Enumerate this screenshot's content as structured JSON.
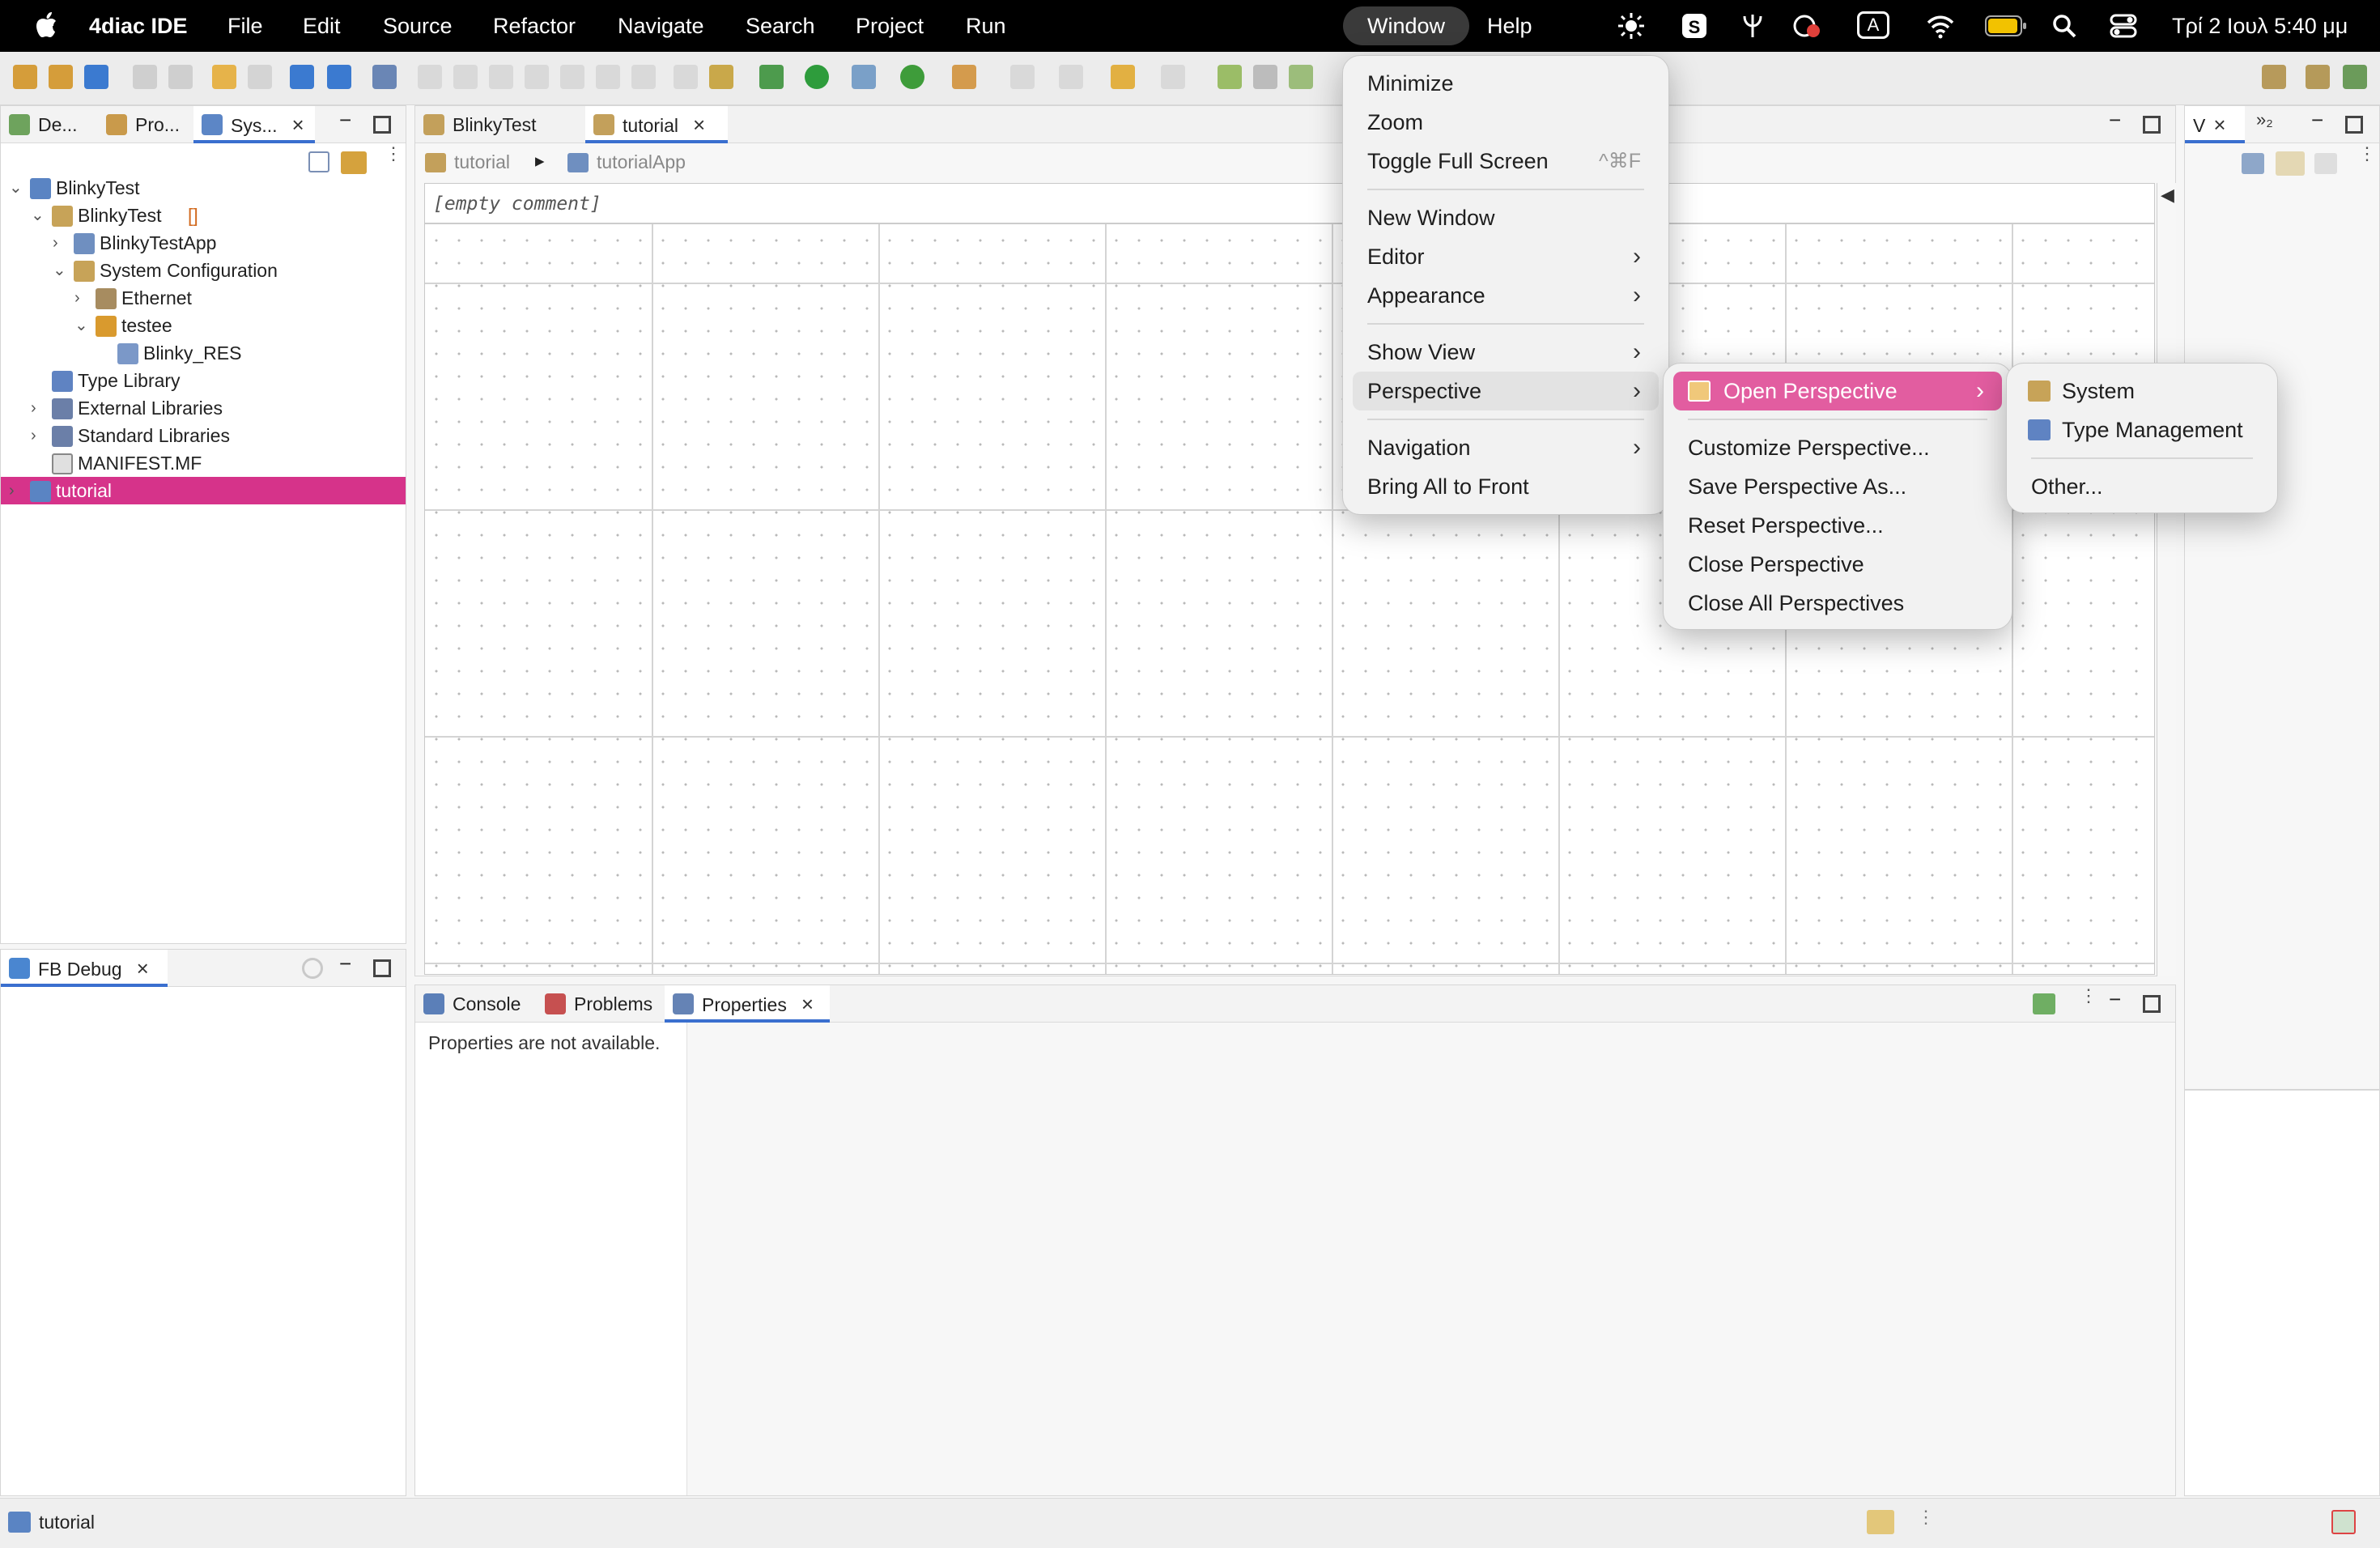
{
  "menubar": {
    "app_name": "4diac IDE",
    "items": [
      "File",
      "Edit",
      "Source",
      "Refactor",
      "Navigate",
      "Search",
      "Project",
      "Run",
      "Window",
      "Help"
    ],
    "active": "Window",
    "input_indicator": "A",
    "datetime": "Τρί 2 Ιουλ  5:40 μμ"
  },
  "left_top_panel": {
    "tabs": [
      {
        "label": "De...",
        "icon": "debug-icon"
      },
      {
        "label": "Pro...",
        "icon": "project-icon"
      },
      {
        "label": "Sys...",
        "icon": "system-explorer-icon"
      }
    ],
    "tree": [
      {
        "label": "BlinkyTest",
        "depth": 0,
        "arrow": "open",
        "icon": "system-file-icon"
      },
      {
        "label": "BlinkyTest",
        "suffix": "[]",
        "depth": 1,
        "arrow": "open",
        "icon": "app-icon"
      },
      {
        "label": "BlinkyTestApp",
        "depth": 2,
        "arrow": "closed",
        "icon": "fb-network-icon"
      },
      {
        "label": "System Configuration",
        "depth": 2,
        "arrow": "open",
        "icon": "system-config-icon"
      },
      {
        "label": "Ethernet",
        "depth": 3,
        "arrow": "closed",
        "icon": "ethernet-icon"
      },
      {
        "label": "testee",
        "depth": 3,
        "arrow": "open",
        "icon": "device-icon"
      },
      {
        "label": "Blinky_RES",
        "depth": 4,
        "arrow": "none",
        "icon": "resource-icon"
      },
      {
        "label": "Type Library",
        "depth": 1,
        "arrow": "none",
        "icon": "type-library-icon"
      },
      {
        "label": "External Libraries",
        "depth": 1,
        "arrow": "closed",
        "icon": "library-icon"
      },
      {
        "label": "Standard Libraries",
        "depth": 1,
        "arrow": "closed",
        "icon": "library-icon"
      },
      {
        "label": "MANIFEST.MF",
        "depth": 1,
        "arrow": "none",
        "icon": "manifest-file-icon"
      },
      {
        "label": "tutorial",
        "depth": 0,
        "arrow": "closed",
        "icon": "system-file-icon",
        "selected": true
      }
    ]
  },
  "left_bottom_panel": {
    "tab_label": "FB Debug"
  },
  "editor": {
    "tabs": [
      {
        "label": "BlinkyTest"
      },
      {
        "label": "tutorial",
        "active": true
      }
    ],
    "breadcrumb": [
      "tutorial",
      "tutorialApp"
    ],
    "comment": "[empty comment]"
  },
  "bottom_panel": {
    "tabs": [
      {
        "label": "Console"
      },
      {
        "label": "Problems"
      },
      {
        "label": "Properties",
        "active": true
      }
    ],
    "message": "Properties are not available."
  },
  "right_panel": {
    "tab_label": "V"
  },
  "window_menu": {
    "items": [
      {
        "label": "Minimize"
      },
      {
        "label": "Zoom"
      },
      {
        "label": "Toggle Full Screen",
        "shortcut": "^⌘F"
      },
      {
        "label": "New Window"
      },
      {
        "label": "Editor",
        "submenu": true
      },
      {
        "label": "Appearance",
        "submenu": true
      },
      {
        "label": "Show View",
        "submenu": true
      },
      {
        "label": "Perspective",
        "submenu": true,
        "hover": true
      },
      {
        "label": "Navigation",
        "submenu": true
      },
      {
        "label": "Bring All to Front"
      }
    ]
  },
  "perspective_menu": {
    "items": [
      {
        "label": "Open Perspective",
        "submenu": true,
        "highlighted": true
      },
      {
        "label": "Customize Perspective..."
      },
      {
        "label": "Save Perspective As..."
      },
      {
        "label": "Reset Perspective..."
      },
      {
        "label": "Close Perspective"
      },
      {
        "label": "Close All Perspectives"
      }
    ]
  },
  "open_perspective_menu": {
    "items": [
      {
        "label": "System",
        "icon": "system-perspective-icon"
      },
      {
        "label": "Type Management",
        "icon": "type-management-icon"
      },
      {
        "label": "Other..."
      }
    ]
  },
  "status_bar": {
    "text": "tutorial"
  },
  "colors": {
    "selection": "#d6338a",
    "menu_highlight": "#e25da0",
    "accent": "#3a6fcf"
  }
}
